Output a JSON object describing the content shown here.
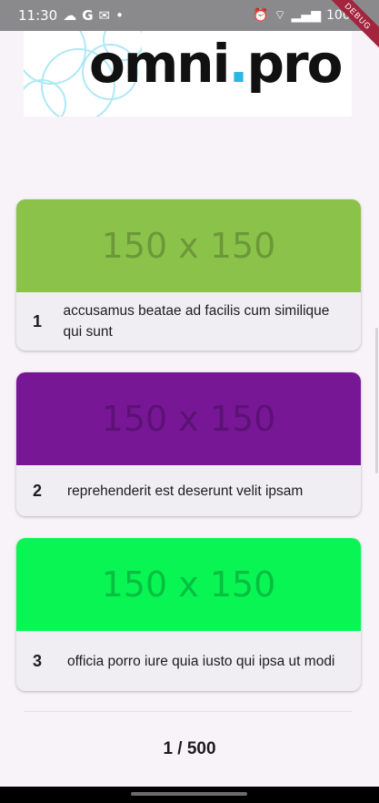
{
  "status_bar": {
    "time": "11:30",
    "left_icons": [
      "cloud-icon",
      "google-icon",
      "gmail-icon",
      "dot-icon"
    ],
    "battery": "100%",
    "debug_label": "DEBUG"
  },
  "logo": {
    "text_part1": "omni",
    "dot": ".",
    "text_part2": "pro"
  },
  "cards": [
    {
      "number": "1",
      "image_label": "150 x 150",
      "image_color": "#8bc34a",
      "title": "accusamus beatae ad facilis cum similique qui sunt"
    },
    {
      "number": "2",
      "image_label": "150 x 150",
      "image_color": "#771796",
      "title": "reprehenderit est deserunt velit ipsam"
    },
    {
      "number": "3",
      "image_label": "150 x 150",
      "image_color": "#08f553",
      "title": "officia porro iure quia iusto qui ipsa ut modi"
    }
  ],
  "pagination": {
    "text": "1 / 500"
  }
}
